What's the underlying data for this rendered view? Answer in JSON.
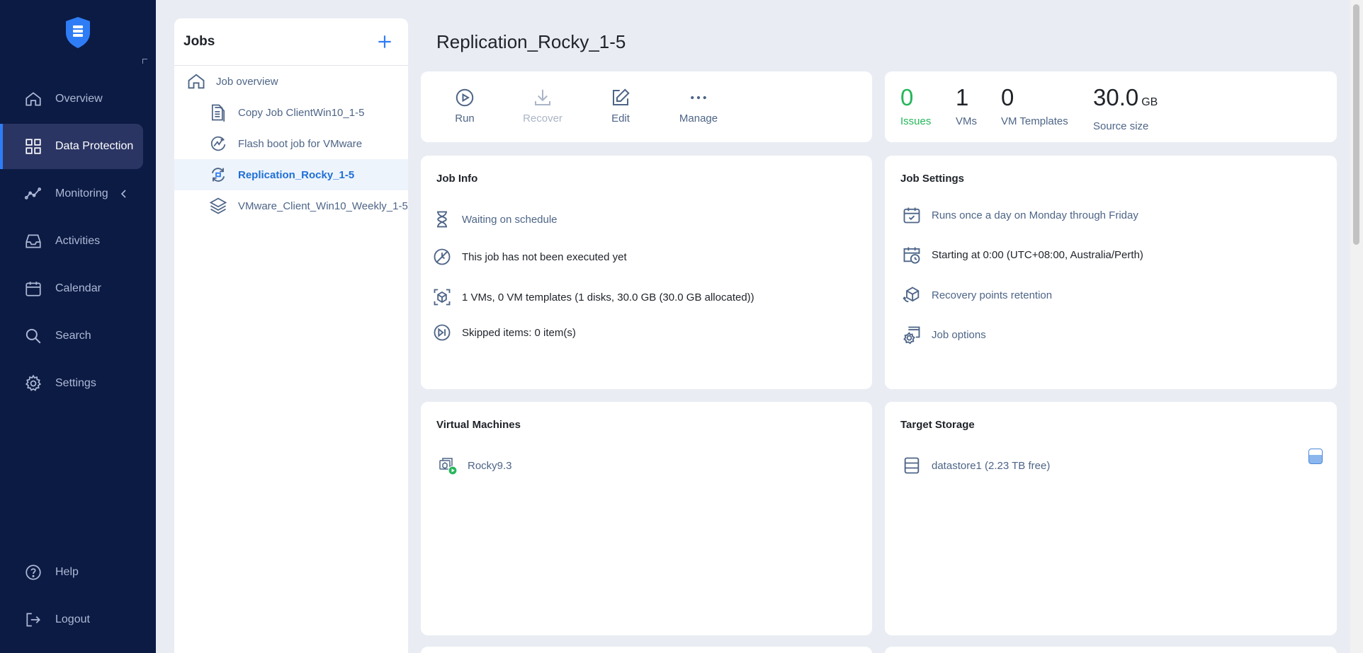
{
  "sidebar": {
    "items": [
      {
        "label": "Overview"
      },
      {
        "label": "Data Protection"
      },
      {
        "label": "Monitoring"
      },
      {
        "label": "Activities"
      },
      {
        "label": "Calendar"
      },
      {
        "label": "Search"
      },
      {
        "label": "Settings"
      }
    ],
    "footer": [
      {
        "label": "Help"
      },
      {
        "label": "Logout"
      }
    ]
  },
  "jobs": {
    "title": "Jobs",
    "overview_label": "Job overview",
    "items": [
      {
        "label": "Copy Job ClientWin10_1-5"
      },
      {
        "label": "Flash boot job for VMware"
      },
      {
        "label": "Replication_Rocky_1-5"
      },
      {
        "label": "VMware_Client_Win10_Weekly_1-5"
      }
    ]
  },
  "page": {
    "title": "Replication_Rocky_1-5"
  },
  "toolbar": {
    "run": "Run",
    "recover": "Recover",
    "edit": "Edit",
    "manage": "Manage"
  },
  "stats": {
    "issues": {
      "value": "0",
      "label": "Issues"
    },
    "vms": {
      "value": "1",
      "label": "VMs"
    },
    "vm_templates": {
      "value": "0",
      "label": "VM Templates"
    },
    "source_size": {
      "value": "30.0",
      "unit": "GB",
      "label": "Source size"
    }
  },
  "job_info": {
    "title": "Job Info",
    "status": "Waiting on schedule",
    "last_run": "This job has not been executed yet",
    "objects": "1 VMs, 0 VM templates (1 disks, 30.0 GB (30.0 GB allocated))",
    "skipped": "Skipped items: 0 item(s)"
  },
  "job_settings": {
    "title": "Job Settings",
    "schedule": "Runs once a day on Monday through Friday",
    "start": "Starting at 0:00 (UTC+08:00, Australia/Perth)",
    "retention": "Recovery points retention",
    "options": "Job options"
  },
  "virtual_machines": {
    "title": "Virtual Machines",
    "items": [
      {
        "label": "Rocky9.3"
      }
    ]
  },
  "target_storage": {
    "title": "Target Storage",
    "items": [
      {
        "label": "datastore1 (2.23 TB free)"
      }
    ]
  },
  "colors": {
    "sidebar_bg": "#0c1b44",
    "accent": "#2f7df6",
    "success": "#25b65a",
    "link": "#4e6587"
  }
}
